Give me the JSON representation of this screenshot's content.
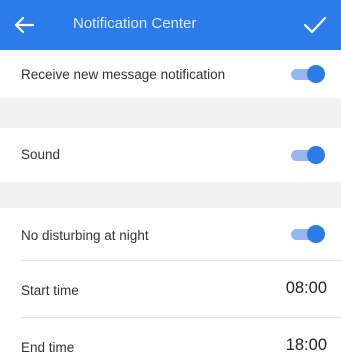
{
  "header": {
    "title": "Notification Center",
    "back_icon": "back-arrow-icon",
    "confirm_icon": "checkmark-icon",
    "background_color": "#2b7bea"
  },
  "settings": {
    "new_message": {
      "label": "Receive new message notification",
      "enabled": true
    },
    "sound": {
      "label": "Sound",
      "enabled": true
    },
    "no_disturb": {
      "label": "No disturbing at night",
      "enabled": true
    },
    "start_time": {
      "label": "Start time",
      "value": "08:00"
    },
    "end_time": {
      "label": "End time",
      "value": "18:00"
    }
  },
  "colors": {
    "accent": "#2b7bea",
    "toggle_track": "#93b7ee",
    "section_gap": "#f1f1f1"
  }
}
